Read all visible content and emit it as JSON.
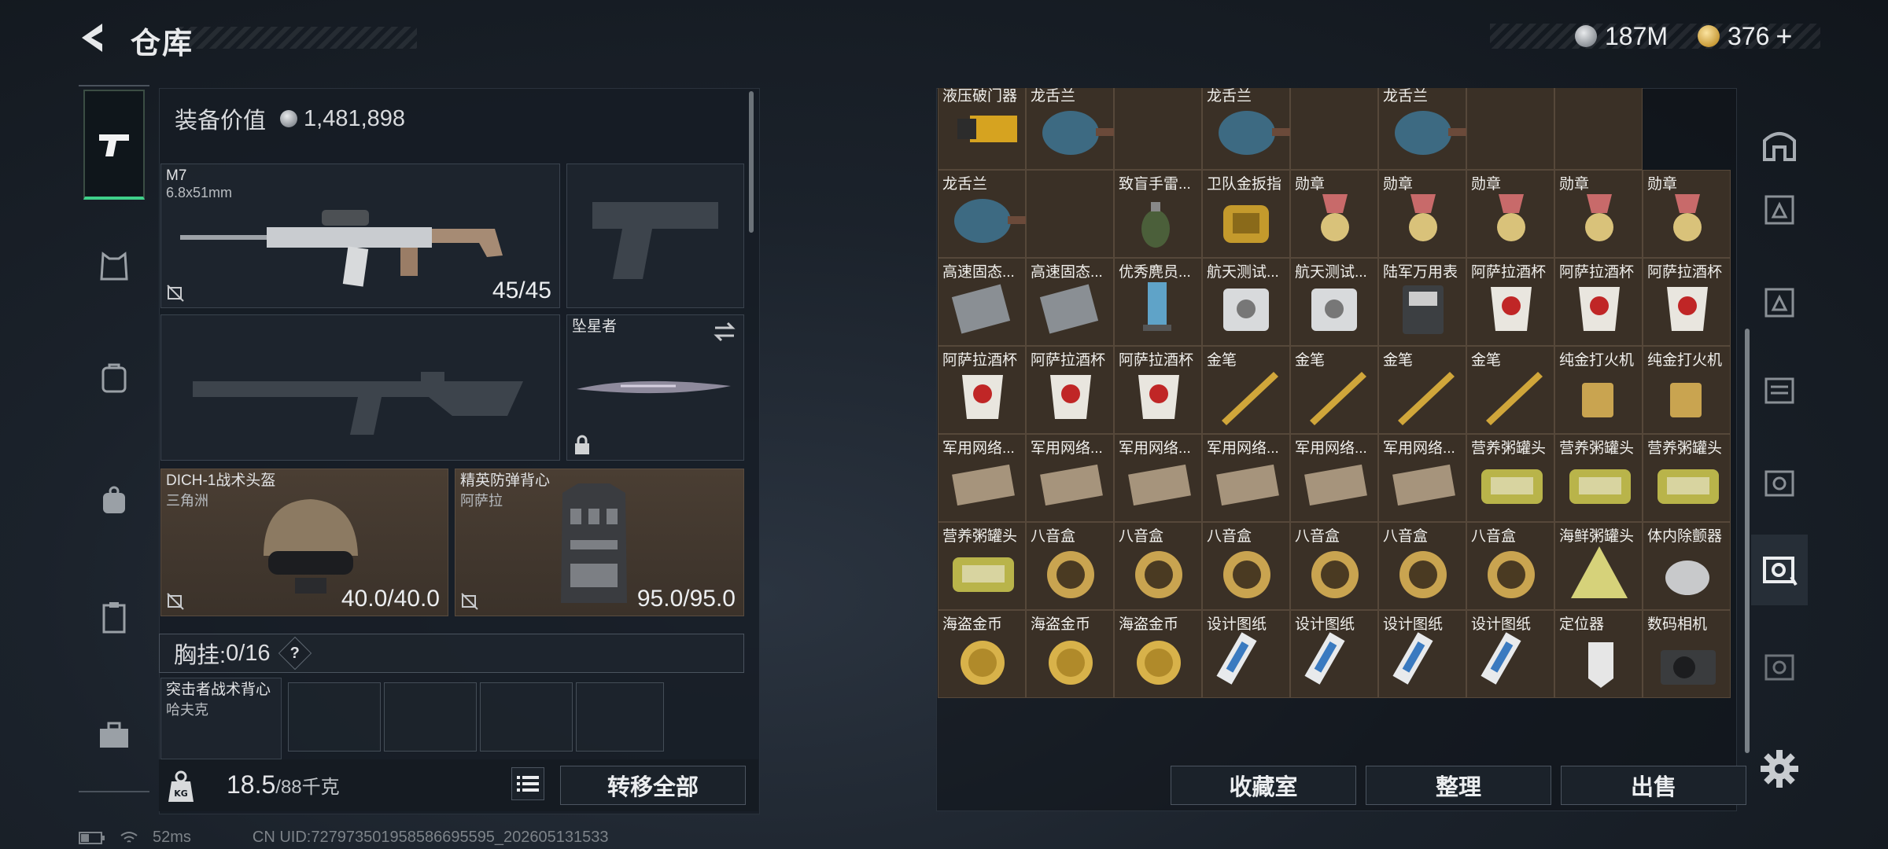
{
  "header": {
    "title": "仓库",
    "currency": [
      {
        "icon": "silver-coin-icon",
        "value": "187M"
      },
      {
        "icon": "gold-coin-icon",
        "value": "376"
      }
    ],
    "plus": "+"
  },
  "left_nav": [
    "weapon-icon",
    "armor-icon",
    "backpack-icon",
    "bag-icon",
    "clipboard-icon",
    "toolbox-icon"
  ],
  "equipment": {
    "value_label": "装备价值",
    "value": "1,481,898",
    "primary": {
      "name": "M7",
      "caliber": "6.8x51mm",
      "ammo": "45/45"
    },
    "melee": {
      "name": "坠星者"
    },
    "helmet": {
      "name": "DICH-1战术头盔",
      "map": "三角洲",
      "durability": "40.0/40.0"
    },
    "vest": {
      "name": "精英防弹背心",
      "map": "阿萨拉",
      "durability": "95.0/95.0"
    },
    "chest": {
      "label": "胸挂:",
      "count": "0/16",
      "help": "?"
    },
    "backpack": {
      "name": "突击者战术背心",
      "sub": "哈夫克"
    },
    "weight": {
      "value": "18.5",
      "max": "/88千克"
    },
    "transfer_all": "转移全部"
  },
  "grid": {
    "rows": [
      [
        "液压破门器",
        "龙舌兰",
        "",
        "龙舌兰",
        "",
        "龙舌兰",
        "",
        ""
      ],
      [
        "龙舌兰",
        "",
        "致盲手雷...",
        "卫队金扳指",
        "勋章",
        "勋章",
        "勋章",
        "勋章",
        "勋章"
      ],
      [
        "高速固态...",
        "高速固态...",
        "优秀麂员...",
        "航天测试...",
        "航天测试...",
        "陆军万用表",
        "阿萨拉酒杯",
        "阿萨拉酒杯",
        "阿萨拉酒杯"
      ],
      [
        "阿萨拉酒杯",
        "阿萨拉酒杯",
        "阿萨拉酒杯",
        "金笔",
        "金笔",
        "金笔",
        "金笔",
        "纯金打火机",
        "纯金打火机"
      ],
      [
        "军用网络...",
        "军用网络...",
        "军用网络...",
        "军用网络...",
        "军用网络...",
        "军用网络...",
        "营养粥罐头",
        "营养粥罐头",
        "营养粥罐头"
      ],
      [
        "营养粥罐头",
        "八音盒",
        "八音盒",
        "八音盒",
        "八音盒",
        "八音盒",
        "八音盒",
        "海鲜粥罐头",
        "体内除颤器"
      ],
      [
        "海盗金币",
        "海盗金币",
        "海盗金币",
        "设计图纸",
        "设计图纸",
        "设计图纸",
        "设计图纸",
        "定位器",
        "数码相机"
      ]
    ]
  },
  "actions": {
    "collection": "收藏室",
    "sort": "整理",
    "sell": "出售"
  },
  "right_nav": [
    "bunker-icon",
    "tier-5-icon",
    "tier-4-icon",
    "tier-4b-icon",
    "tier-5b-icon",
    "tier-5c-icon",
    "tier-5d-icon"
  ],
  "status": {
    "ping": "52ms",
    "uid": "CN UID:727973501958586695595_202605131533"
  }
}
